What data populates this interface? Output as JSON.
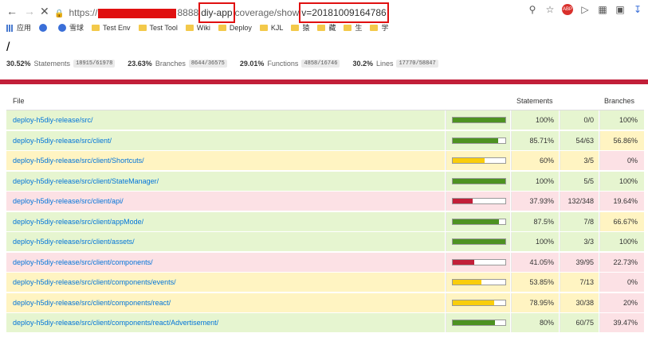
{
  "browser": {
    "url_prefix": "https://",
    "url_port": "8888",
    "url_app": "diy-app",
    "url_path": "coverage/show",
    "url_query": "v=20181009164786"
  },
  "bookmarks": {
    "apps_label": "应用",
    "items": [
      "雪球",
      "Test Env",
      "Test Tool",
      "Wiki",
      "Deploy",
      "KJL",
      "猿",
      "藏",
      "生",
      "学"
    ]
  },
  "page": {
    "path": "/",
    "summary": [
      {
        "pct": "30.52%",
        "label": "Statements",
        "frac": "18915/61978"
      },
      {
        "pct": "23.63%",
        "label": "Branches",
        "frac": "8644/36575"
      },
      {
        "pct": "29.01%",
        "label": "Functions",
        "frac": "4858/16746"
      },
      {
        "pct": "30.2%",
        "label": "Lines",
        "frac": "17770/58847"
      }
    ]
  },
  "table": {
    "headers": {
      "file": "File",
      "statements": "Statements",
      "branches": "Branches"
    },
    "rows": [
      {
        "file": "deploy-h5diy-release/src/",
        "stmt_pct": "100%",
        "stmt_frac": "0/0",
        "branch_pct": "100%",
        "stmt_level": "high",
        "branch_level": "high",
        "fill": 1.0
      },
      {
        "file": "deploy-h5diy-release/src/client/",
        "stmt_pct": "85.71%",
        "stmt_frac": "54/63",
        "branch_pct": "56.86%",
        "stmt_level": "high",
        "branch_level": "medium",
        "fill": 0.8571
      },
      {
        "file": "deploy-h5diy-release/src/client/Shortcuts/",
        "stmt_pct": "60%",
        "stmt_frac": "3/5",
        "branch_pct": "0%",
        "stmt_level": "medium",
        "branch_level": "low",
        "fill": 0.6
      },
      {
        "file": "deploy-h5diy-release/src/client/StateManager/",
        "stmt_pct": "100%",
        "stmt_frac": "5/5",
        "branch_pct": "100%",
        "stmt_level": "high",
        "branch_level": "high",
        "fill": 1.0
      },
      {
        "file": "deploy-h5diy-release/src/client/api/",
        "stmt_pct": "37.93%",
        "stmt_frac": "132/348",
        "branch_pct": "19.64%",
        "stmt_level": "low",
        "branch_level": "low",
        "fill": 0.3793
      },
      {
        "file": "deploy-h5diy-release/src/client/appMode/",
        "stmt_pct": "87.5%",
        "stmt_frac": "7/8",
        "branch_pct": "66.67%",
        "stmt_level": "high",
        "branch_level": "medium",
        "fill": 0.875
      },
      {
        "file": "deploy-h5diy-release/src/client/assets/",
        "stmt_pct": "100%",
        "stmt_frac": "3/3",
        "branch_pct": "100%",
        "stmt_level": "high",
        "branch_level": "high",
        "fill": 1.0
      },
      {
        "file": "deploy-h5diy-release/src/client/components/",
        "stmt_pct": "41.05%",
        "stmt_frac": "39/95",
        "branch_pct": "22.73%",
        "stmt_level": "low",
        "branch_level": "low",
        "fill": 0.4105
      },
      {
        "file": "deploy-h5diy-release/src/client/components/events/",
        "stmt_pct": "53.85%",
        "stmt_frac": "7/13",
        "branch_pct": "0%",
        "stmt_level": "medium",
        "branch_level": "low",
        "fill": 0.5385
      },
      {
        "file": "deploy-h5diy-release/src/client/components/react/",
        "stmt_pct": "78.95%",
        "stmt_frac": "30/38",
        "branch_pct": "20%",
        "stmt_level": "medium",
        "branch_level": "low",
        "fill": 0.7895
      },
      {
        "file": "deploy-h5diy-release/src/client/components/react/Advertisement/",
        "stmt_pct": "80%",
        "stmt_frac": "60/75",
        "branch_pct": "39.47%",
        "stmt_level": "high",
        "branch_level": "low",
        "fill": 0.8
      }
    ]
  },
  "colors": {
    "high": "#e6f5d0",
    "medium": "#fff4c2",
    "low": "#fce1e5",
    "accent_bar": "#c21f39"
  }
}
